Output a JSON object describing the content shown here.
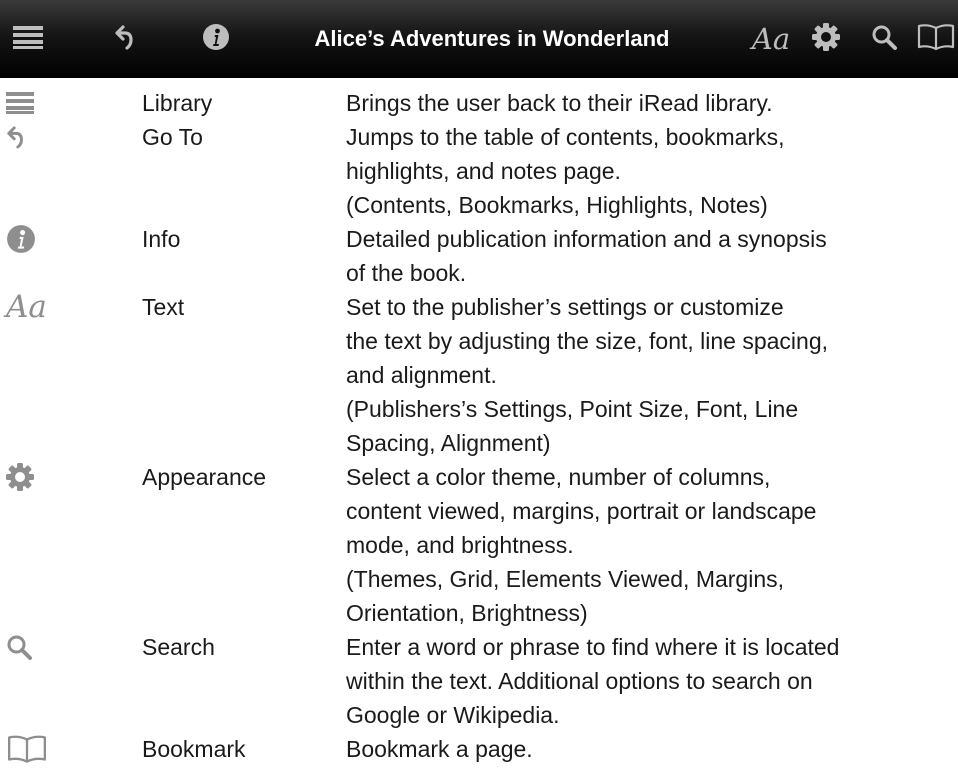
{
  "toolbar": {
    "title": "Alice’s Adventures in Wonderland",
    "text_label": "Aa",
    "icons": [
      "list-icon",
      "back-arrow-icon",
      "info-icon",
      "text-format-icon",
      "gear-icon",
      "search-icon",
      "book-icon"
    ]
  },
  "legend": [
    {
      "icon": "list-icon",
      "label": "Library",
      "description": [
        "Brings the user back to their iRead library."
      ]
    },
    {
      "icon": "back-arrow-icon",
      "label": "Go To",
      "description": [
        "Jumps to the table of contents, bookmarks,",
        "highlights, and notes page.",
        "(Contents, Bookmarks, Highlights, Notes)"
      ]
    },
    {
      "icon": "info-icon",
      "label": "Info",
      "description": [
        "Detailed publication information and a synopsis",
        "of the book."
      ]
    },
    {
      "icon": "text-format-icon",
      "icon_text": "Aa",
      "label": "Text",
      "description": [
        "Set to the publisher’s settings or customize",
        "the text by adjusting the size, font, line spacing,",
        "and alignment.",
        "(Publishers’s Settings, Point Size, Font, Line",
        "Spacing, Alignment)"
      ]
    },
    {
      "icon": "gear-icon",
      "label": "Appearance",
      "description": [
        "Select a color theme, number of columns,",
        "content viewed, margins, portrait or landscape",
        "mode, and brightness.",
        "(Themes, Grid, Elements Viewed, Margins,",
        "Orientation, Brightness)"
      ]
    },
    {
      "icon": "search-icon",
      "label": "Search",
      "description": [
        "Enter a word or phrase to find where it is located",
        "within the text. Additional options to search on",
        "Google or Wikipedia."
      ]
    },
    {
      "icon": "book-icon",
      "label": "Bookmark",
      "description": [
        "Bookmark a page."
      ]
    }
  ],
  "colors": {
    "toolbar_background": "#000000",
    "toolbar_icon": "#bdbdbd",
    "legend_icon": "#8e8e8e",
    "text": "#1a1a1a"
  }
}
